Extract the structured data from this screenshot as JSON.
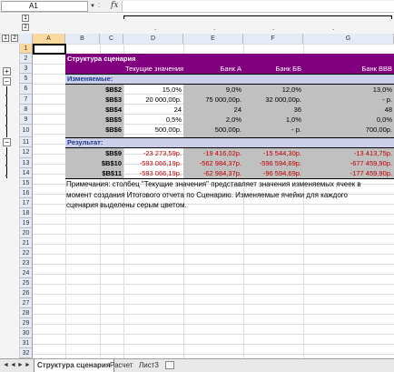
{
  "name_box": "A1",
  "formula_bar": {
    "dots": ":",
    "fx": "fx",
    "content": ""
  },
  "outline": {
    "col_levels": [
      "1",
      "2"
    ],
    "row_levels": [
      "1",
      "2"
    ],
    "col_dots": [
      ".",
      ".",
      ".",
      "."
    ]
  },
  "columns": [
    "A",
    "B",
    "C",
    "D",
    "E",
    "F",
    "G"
  ],
  "rows": [
    "1",
    "2",
    "3",
    "5",
    "6",
    "7",
    "8",
    "9",
    "10",
    "11",
    "12",
    "13",
    "14",
    "15",
    "16",
    "17",
    "18",
    "19",
    "20",
    "21",
    "22",
    "23",
    "24",
    "25",
    "26",
    "27",
    "28",
    "29",
    "30",
    "31",
    "32",
    "33"
  ],
  "outline_buttons": [
    "+",
    "−",
    "−"
  ],
  "report": {
    "title": "Структура сценария",
    "headers": [
      "Текущие значения:",
      "Банк А",
      "Банк ББ",
      "Банк ВВВ"
    ],
    "changing_label": "Изменяемые:",
    "changing_rows": [
      {
        "ref": "$B$2",
        "values": [
          "15,0%",
          "9,0%",
          "12,0%",
          "13,0%"
        ]
      },
      {
        "ref": "$B$3",
        "values": [
          "20 000,00р.",
          "75 000,00р.",
          "32 000,00р.",
          "-   р."
        ]
      },
      {
        "ref": "$B$4",
        "values": [
          "24",
          "24",
          "36",
          "48"
        ]
      },
      {
        "ref": "$B$5",
        "values": [
          "0,5%",
          "2,0%",
          "1,0%",
          "0,0%"
        ]
      },
      {
        "ref": "$B$6",
        "values": [
          "500,00р.",
          "500,00р.",
          "-   р.",
          "700,00р."
        ]
      }
    ],
    "result_label": "Результат:",
    "result_rows": [
      {
        "ref": "$B$9",
        "values": [
          "-23 273,59р.",
          "-19 416,02р.",
          "-15 544,30р.",
          "-13 413,75р."
        ]
      },
      {
        "ref": "$B$10",
        "values": [
          "-593 066,19р.",
          "-562 984,37р.",
          "-596 594,69р.",
          "-677 459,90р."
        ]
      },
      {
        "ref": "$B$11",
        "values": [
          "-593 066,19р.",
          "-62 984,37р.",
          "-96 594,69р.",
          "-177 459,90р."
        ]
      }
    ],
    "note": "Примечания: столбец \"Текущие значения\" представляет значения изменяемых ячеек в момент создания Итогового отчета по Сценарию. Изменяемые ячейки для каждого сценария выделены серым цветом."
  },
  "tabs": {
    "nav": [
      "◄",
      "◄",
      "►",
      "►"
    ],
    "sheets": [
      "Структура сценария",
      "Расчет",
      "Лист3"
    ]
  },
  "colors": {
    "title_bg": "#80007f",
    "header_bg": "#cccfea",
    "input_bg": "#c0c0c0",
    "negative": "#c00000"
  }
}
